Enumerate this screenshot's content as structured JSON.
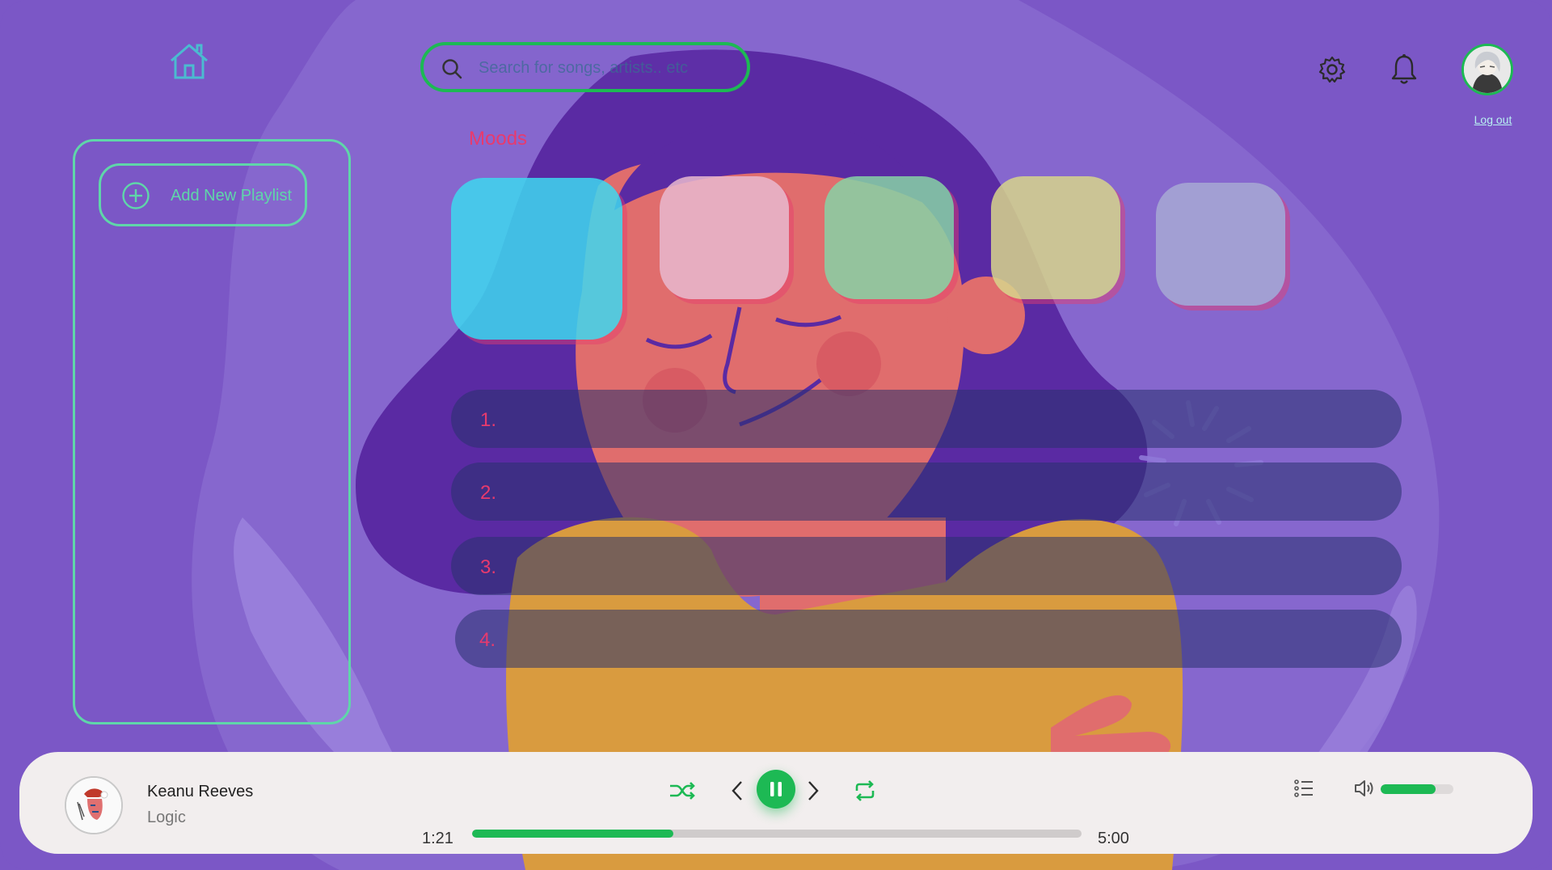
{
  "search": {
    "placeholder": "Search for songs, artists.. etc"
  },
  "header": {
    "logout_label": "Log out"
  },
  "sidebar": {
    "add_playlist_label": "Add New Playlist"
  },
  "moods": {
    "title": "Moods",
    "tiles": [
      {
        "color": "#3ed8f0"
      },
      {
        "color": "#e9b9cf"
      },
      {
        "color": "#87d3a6"
      },
      {
        "color": "#d8d58c"
      },
      {
        "color": "#a8a9d4"
      }
    ]
  },
  "tracks": [
    {
      "number": "1."
    },
    {
      "number": "2."
    },
    {
      "number": "3."
    },
    {
      "number": "4."
    }
  ],
  "player": {
    "song_title": "Keanu Reeves",
    "song_artist": "Logic",
    "current_time": "1:21",
    "total_time": "5:00",
    "progress": 0.33,
    "volume": 0.75
  },
  "colors": {
    "accent": "#1db954",
    "background": "#7b57c6",
    "mood_text": "#e83a6d",
    "outline": "#5fd6a9"
  },
  "icons": [
    "home-icon",
    "search-icon",
    "gear-icon",
    "bell-icon",
    "plus-circle-icon",
    "shuffle-icon",
    "previous-icon",
    "pause-icon",
    "next-icon",
    "repeat-icon",
    "queue-list-icon",
    "volume-icon"
  ]
}
